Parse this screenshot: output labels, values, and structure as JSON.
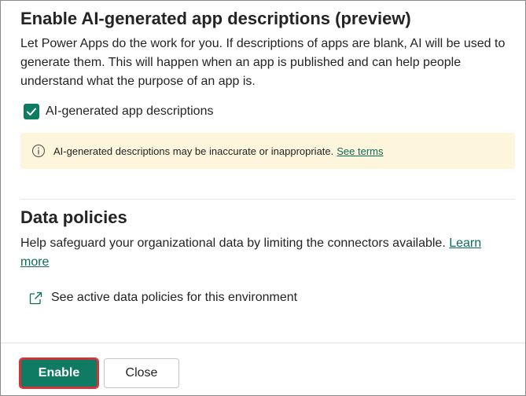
{
  "ai_section": {
    "title": "Enable AI-generated app descriptions (preview)",
    "description": "Let Power Apps do the work for you. If descriptions of apps are blank, AI will be used to generate them. This will happen when an app is published and can help people understand what the purpose of an app is.",
    "checkbox_label": "AI-generated app descriptions",
    "checkbox_checked": true,
    "warning_text": "AI-generated descriptions may be inaccurate or inappropriate.",
    "warning_link": "See terms"
  },
  "data_policies": {
    "title": "Data policies",
    "description": "Help safeguard your organizational data by limiting the connectors available.",
    "learn_more": "Learn more",
    "external_link_text": "See active data policies for this environment"
  },
  "footer": {
    "primary_label": "Enable",
    "secondary_label": "Close"
  },
  "colors": {
    "accent": "#0f7b62",
    "link": "#0f6b59",
    "warning_bg": "#fdf6dc",
    "highlight": "#d13438"
  },
  "icons": {
    "checkbox": "checkmark-icon",
    "warning": "info-icon",
    "external_link": "open-external-icon"
  }
}
